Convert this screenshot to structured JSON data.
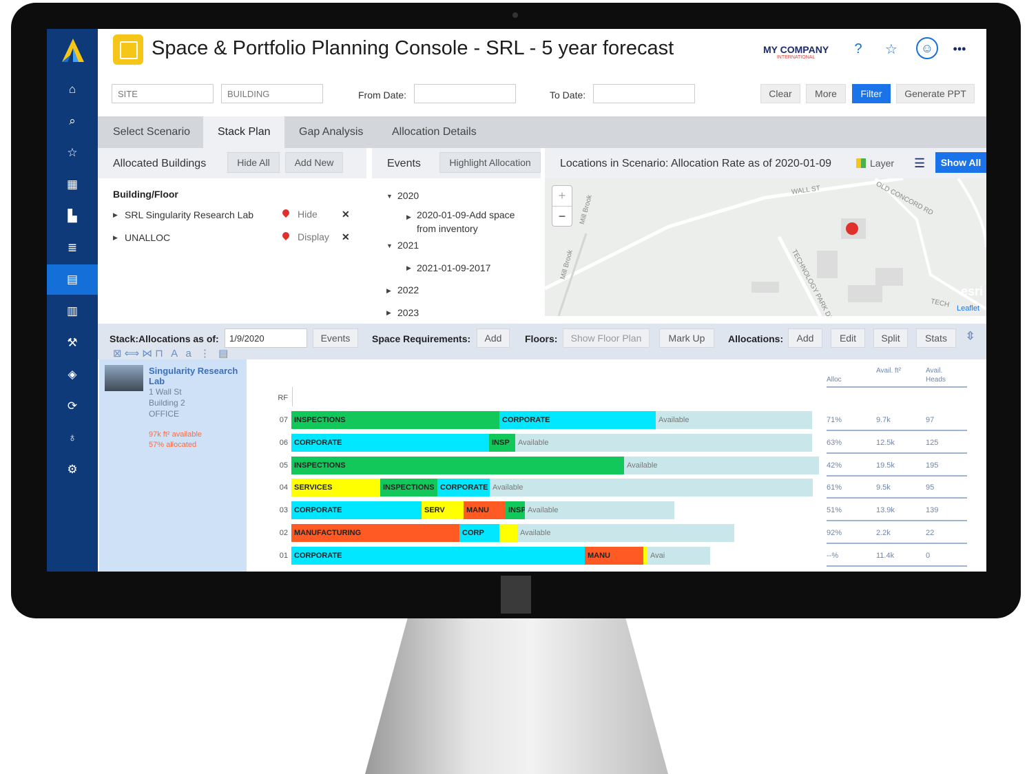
{
  "app": {
    "title": "Space & Portfolio Planning Console - SRL - 5 year forecast",
    "company": "MY COMPANY",
    "company_sub": "INTERNATIONAL"
  },
  "nav": [
    "home-icon",
    "search-icon",
    "star-icon",
    "grid-icon",
    "building-icon",
    "chart-icon",
    "stack-plan-icon",
    "report-icon",
    "wrench-icon",
    "compass-icon",
    "sync-icon",
    "bulb-icon",
    "gear-icon"
  ],
  "filters": {
    "site_placeholder": "SITE",
    "building_placeholder": "BUILDING",
    "from_label": "From Date:",
    "to_label": "To Date:",
    "clear": "Clear",
    "more": "More",
    "filter": "Filter",
    "ppt": "Generate PPT"
  },
  "tabs": [
    "Select Scenario",
    "Stack Plan",
    "Gap Analysis",
    "Allocation Details"
  ],
  "buildings_panel": {
    "title": "Allocated Buildings",
    "hide_all": "Hide All",
    "add_new": "Add New",
    "header": "Building/Floor",
    "rows": [
      {
        "label": "SRL Singularity Research Lab",
        "action": "Hide"
      },
      {
        "label": "UNALLOC",
        "action": "Display"
      }
    ]
  },
  "events_panel": {
    "title": "Events",
    "highlight": "Highlight Allocation",
    "tree": [
      {
        "year": "2020",
        "item": "2020-01-09-Add space from inventory"
      },
      {
        "year": "2021",
        "item": "2021-01-09-2017"
      },
      {
        "year": "2022"
      },
      {
        "year": "2023"
      }
    ]
  },
  "map_panel": {
    "title": "Locations in Scenario: Allocation Rate as of 2020-01-09",
    "layer": "Layer",
    "show_all": "Show All",
    "zoom_in": "+",
    "zoom_out": "−",
    "labels": [
      "WALL ST",
      "OLD CONCORD RD",
      "TECHNOLOGY PARK DR",
      "Mill Brook",
      "Mill Brook",
      "TECH",
      "esri",
      "Leaflet"
    ]
  },
  "stack_toolbar": {
    "as_of_label": "Stack:Allocations as of:",
    "as_of_value": "1/9/2020",
    "events": "Events",
    "space_req_label": "Space Requirements:",
    "add": "Add",
    "floors_label": "Floors:",
    "show_floor_plan": "Show Floor Plan",
    "mark_up": "Mark Up",
    "allocations_label": "Allocations:",
    "alloc_add": "Add",
    "edit": "Edit",
    "split": "Split",
    "stats": "Stats"
  },
  "building_card": {
    "name": "Singularity Research Lab",
    "address": "1 Wall St",
    "building": "Building 2",
    "type": "OFFICE",
    "available": "97k ft² available",
    "allocated": "57% allocated"
  },
  "colors": {
    "INSPECTIONS": "#13c85a",
    "CORPORATE": "#00e7ff",
    "SERVICES": "#ffff00",
    "MANUFACTURING": "#ff5a24",
    "Available": "#c9e7ea"
  },
  "chart_data": {
    "type": "bar",
    "stacked": true,
    "orientation": "horizontal",
    "rf_label": "RF",
    "stats_headers": [
      "Alloc",
      "Avail. ft²",
      "Avail. Heads"
    ],
    "floors": [
      {
        "floor": "07",
        "segments": [
          {
            "label": "INSPECTIONS",
            "group": "INSPECTIONS",
            "share": 0.4
          },
          {
            "label": "CORPORATE",
            "group": "CORPORATE",
            "share": 0.3
          },
          {
            "label": "Available",
            "group": "Available",
            "share": 0.3
          }
        ],
        "alloc": "71%",
        "avail_ft": "9.7k",
        "avail_heads": "97"
      },
      {
        "floor": "06",
        "segments": [
          {
            "label": "CORPORATE",
            "group": "CORPORATE",
            "share": 0.38
          },
          {
            "label": "INSP",
            "group": "INSPECTIONS",
            "share": 0.05
          },
          {
            "label": "Available",
            "group": "Available",
            "share": 0.57
          }
        ],
        "alloc": "63%",
        "avail_ft": "12.5k",
        "avail_heads": "125"
      },
      {
        "floor": "05",
        "segments": [
          {
            "label": "INSPECTIONS",
            "group": "INSPECTIONS",
            "share": 0.63
          },
          {
            "label": "Available",
            "group": "Available",
            "share": 0.37
          }
        ],
        "alloc": "42%",
        "avail_ft": "19.5k",
        "avail_heads": "195"
      },
      {
        "floor": "04",
        "segments": [
          {
            "label": "SERVICES",
            "group": "SERVICES",
            "share": 0.17
          },
          {
            "label": "INSPECTIONS",
            "group": "INSPECTIONS",
            "share": 0.11
          },
          {
            "label": "CORPORATE",
            "group": "CORPORATE",
            "share": 0.1
          },
          {
            "label": "Available",
            "group": "Available",
            "share": 0.62
          }
        ],
        "alloc": "61%",
        "avail_ft": "9.5k",
        "avail_heads": "95"
      },
      {
        "floor": "03",
        "segments": [
          {
            "label": "CORPORATE",
            "group": "CORPORATE",
            "share": 0.34
          },
          {
            "label": "SERV",
            "group": "SERVICES",
            "share": 0.11
          },
          {
            "label": "MANU",
            "group": "MANUFACTURING",
            "share": 0.11
          },
          {
            "label": "INSP",
            "group": "INSPECTIONS",
            "share": 0.05
          },
          {
            "label": "Available",
            "group": "Available",
            "share": 0.39
          }
        ],
        "alloc": "51%",
        "avail_ft": "13.9k",
        "avail_heads": "139"
      },
      {
        "floor": "02",
        "segments": [
          {
            "label": "MANUFACTURING",
            "group": "MANUFACTURING",
            "share": 0.38
          },
          {
            "label": "CORP",
            "group": "CORPORATE",
            "share": 0.09
          },
          {
            "label": "",
            "group": "SERVICES",
            "share": 0.04
          },
          {
            "label": "Available",
            "group": "Available",
            "share": 0.49
          }
        ],
        "alloc": "92%",
        "avail_ft": "2.2k",
        "avail_heads": "22"
      },
      {
        "floor": "01",
        "segments": [
          {
            "label": "CORPORATE",
            "group": "CORPORATE",
            "share": 0.7
          },
          {
            "label": "MANU",
            "group": "MANUFACTURING",
            "share": 0.14
          },
          {
            "label": "",
            "group": "SERVICES",
            "share": 0.01
          },
          {
            "label": "Avai",
            "group": "Available",
            "share": 0.15
          }
        ],
        "alloc": "--%",
        "avail_ft": "11.4k",
        "avail_heads": "0"
      }
    ]
  }
}
